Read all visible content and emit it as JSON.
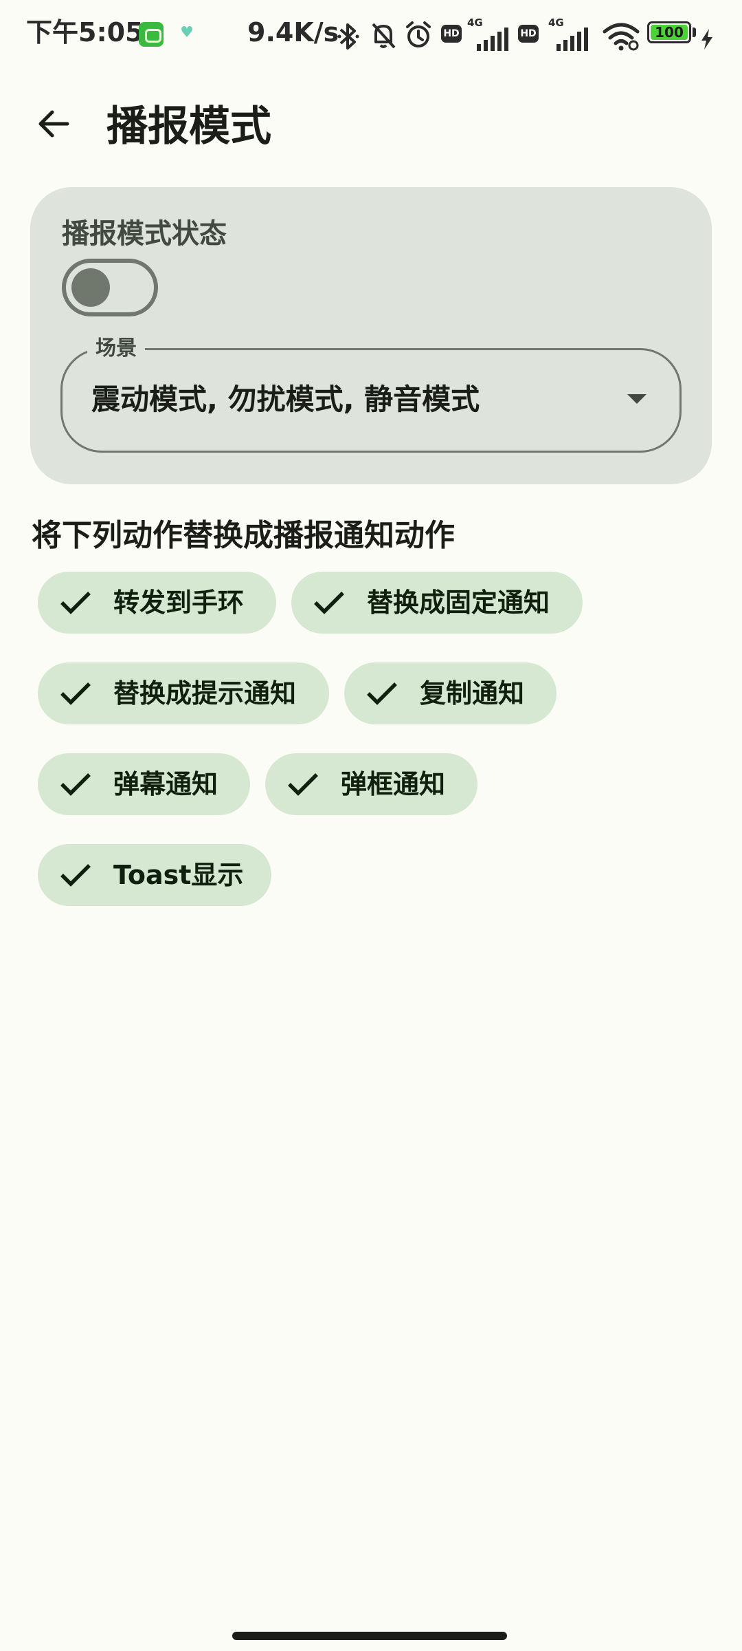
{
  "status_bar": {
    "time": "下午5:05",
    "net_speed": "9.4K/s",
    "hd_label": "HD",
    "network_type": "4G",
    "battery_level": "100",
    "icons": [
      "app-notification-icon",
      "heart-icon",
      "bluetooth-icon",
      "mute-icon",
      "alarm-icon",
      "signal-sim1-icon",
      "signal-sim2-icon",
      "wifi-icon",
      "battery-icon",
      "charging-icon"
    ]
  },
  "app_bar": {
    "back_icon": "arrow-left-icon",
    "title": "播报模式"
  },
  "card": {
    "status_label": "播报模式状态",
    "switch_on": false,
    "scene_label": "场景",
    "scene_value": "震动模式, 勿扰模式, 静音模式",
    "scene_icon": "dropdown-arrow-icon"
  },
  "actions": {
    "title": "将下列动作替换成播报通知动作",
    "chips": [
      {
        "label": "转发到手环",
        "selected": true
      },
      {
        "label": "替换成固定通知",
        "selected": true
      },
      {
        "label": "替换成提示通知",
        "selected": true
      },
      {
        "label": "复制通知",
        "selected": true
      },
      {
        "label": "弹幕通知",
        "selected": true
      },
      {
        "label": "弹框通知",
        "selected": true
      },
      {
        "label": "Toast显示",
        "selected": true
      }
    ]
  },
  "colors": {
    "background": "#fbfcf6",
    "card": "#dee4dc",
    "chip": "#d6e8d2",
    "outline": "#70786d",
    "text": "#1b1d19"
  }
}
